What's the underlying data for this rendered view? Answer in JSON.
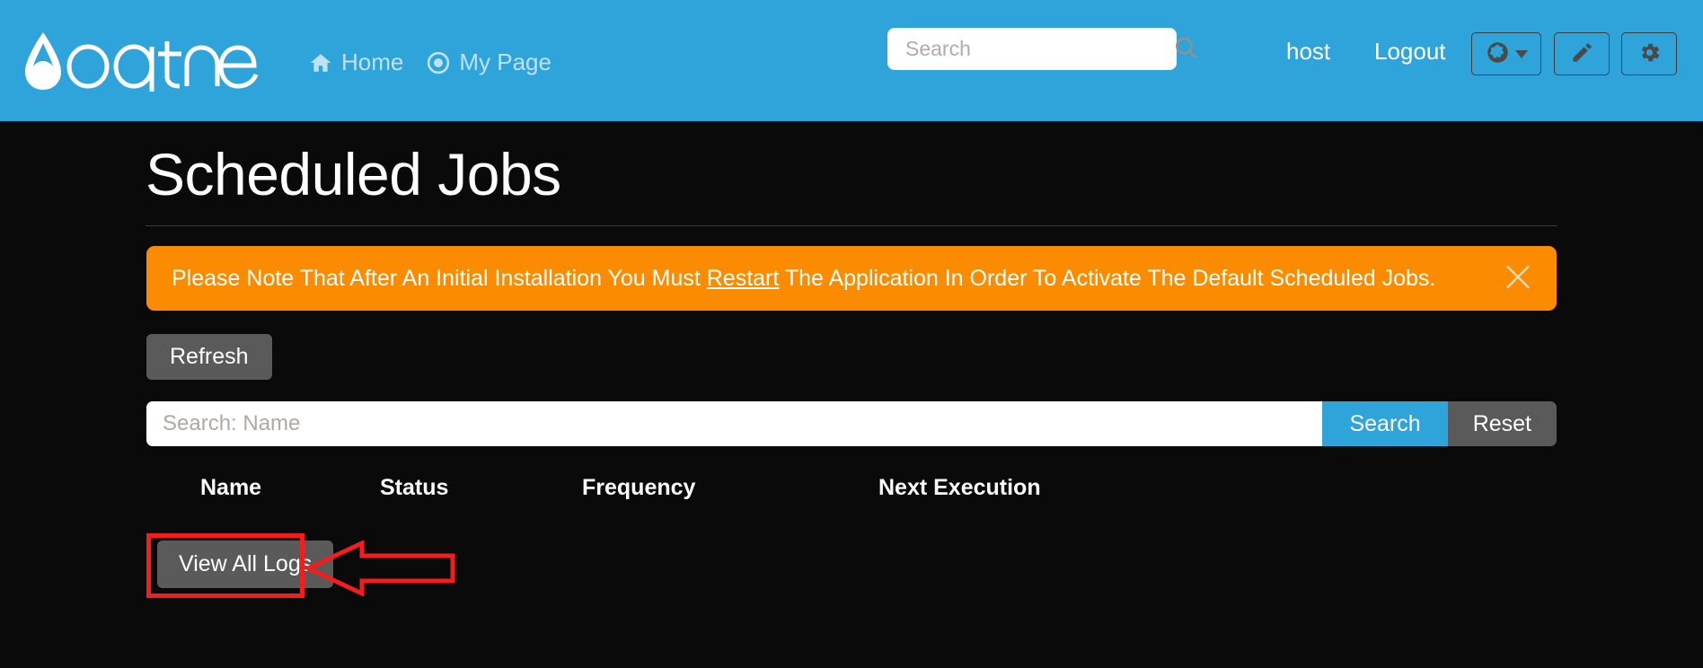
{
  "brand": {
    "name": "oqtane",
    "logo_icon": "water-drop-icon",
    "header_bg": "#2fa4db"
  },
  "nav": {
    "items": [
      {
        "label": "Home",
        "icon": "home-icon"
      },
      {
        "label": "My Page",
        "icon": "target-icon"
      }
    ]
  },
  "search": {
    "placeholder": "Search",
    "value": "",
    "icon": "search-icon"
  },
  "user": {
    "username": "host",
    "logout_label": "Logout"
  },
  "header_buttons": [
    {
      "name": "language-button",
      "icon": "globe-icon",
      "has_caret": true
    },
    {
      "name": "edit-button",
      "icon": "pencil-icon",
      "has_caret": false
    },
    {
      "name": "settings-button",
      "icon": "gear-icon",
      "has_caret": false
    }
  ],
  "page": {
    "title": "Scheduled Jobs"
  },
  "alert": {
    "text_before": "Please Note That After An Initial Installation You Must ",
    "link_text": "Restart",
    "text_after": " The Application In Order To Activate The Default Scheduled Jobs.",
    "bg_color": "#fb8c01",
    "close_icon": "close-icon"
  },
  "toolbar": {
    "refresh_label": "Refresh"
  },
  "filter": {
    "placeholder": "Search: Name",
    "value": "",
    "search_label": "Search",
    "reset_label": "Reset",
    "search_color": "#2fa4db",
    "reset_color": "#5a5a5a"
  },
  "table": {
    "columns": [
      "Name",
      "Status",
      "Frequency",
      "Next Execution"
    ],
    "rows": []
  },
  "footer": {
    "view_all_logs_label": "View All Logs"
  },
  "annotation": {
    "highlight_color": "#f41d1d",
    "target": "view-all-logs-button",
    "shape": "rectangle-and-left-arrow"
  }
}
